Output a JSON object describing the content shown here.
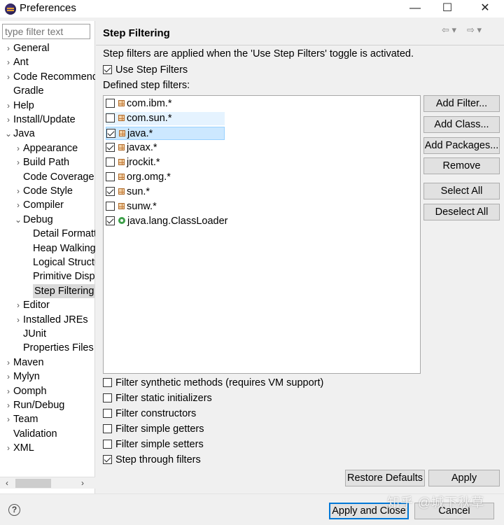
{
  "window": {
    "title": "Preferences",
    "minimize": "—",
    "maximize": "☐",
    "close": "✕"
  },
  "filter": {
    "placeholder": "type filter text"
  },
  "tree": [
    {
      "label": "General",
      "chev": "›"
    },
    {
      "label": "Ant",
      "chev": "›"
    },
    {
      "label": "Code Recommenders",
      "chev": "›"
    },
    {
      "label": "Gradle",
      "chev": ""
    },
    {
      "label": "Help",
      "chev": "›"
    },
    {
      "label": "Install/Update",
      "chev": "›"
    },
    {
      "label": "Java",
      "chev": "⌄"
    },
    {
      "label": "Appearance",
      "chev": "›"
    },
    {
      "label": "Build Path",
      "chev": "›"
    },
    {
      "label": "Code Coverage",
      "chev": ""
    },
    {
      "label": "Code Style",
      "chev": "›"
    },
    {
      "label": "Compiler",
      "chev": "›"
    },
    {
      "label": "Debug",
      "chev": "⌄"
    },
    {
      "label": "Detail Formatters",
      "chev": ""
    },
    {
      "label": "Heap Walking",
      "chev": ""
    },
    {
      "label": "Logical Structures",
      "chev": ""
    },
    {
      "label": "Primitive Display Options",
      "chev": ""
    },
    {
      "label": "Step Filtering",
      "chev": ""
    },
    {
      "label": "Editor",
      "chev": "›"
    },
    {
      "label": "Installed JREs",
      "chev": "›"
    },
    {
      "label": "JUnit",
      "chev": ""
    },
    {
      "label": "Properties Files Editor",
      "chev": ""
    },
    {
      "label": "Maven",
      "chev": "›"
    },
    {
      "label": "Mylyn",
      "chev": "›"
    },
    {
      "label": "Oomph",
      "chev": "›"
    },
    {
      "label": "Run/Debug",
      "chev": "›"
    },
    {
      "label": "Team",
      "chev": "›"
    },
    {
      "label": "Validation",
      "chev": ""
    },
    {
      "label": "XML",
      "chev": "›"
    }
  ],
  "scroll": {
    "left": "‹",
    "right": "›"
  },
  "page": {
    "title": "Step Filtering",
    "nav_back": "⇦ ▾",
    "nav_fwd": "⇨ ▾",
    "description": "Step filters are applied when the 'Use Step Filters' toggle is activated.",
    "use_step_filters": "Use Step Filters",
    "defined_label": "Defined step filters:"
  },
  "filters": [
    {
      "name": "com.ibm.*",
      "checked": false,
      "icon": "package-icon"
    },
    {
      "name": "com.sun.*",
      "checked": false,
      "icon": "package-icon"
    },
    {
      "name": "java.*",
      "checked": true,
      "icon": "package-icon"
    },
    {
      "name": "javax.*",
      "checked": true,
      "icon": "package-icon"
    },
    {
      "name": "jrockit.*",
      "checked": false,
      "icon": "package-icon"
    },
    {
      "name": "org.omg.*",
      "checked": false,
      "icon": "package-icon"
    },
    {
      "name": "sun.*",
      "checked": true,
      "icon": "package-icon"
    },
    {
      "name": "sunw.*",
      "checked": false,
      "icon": "package-icon"
    },
    {
      "name": "java.lang.ClassLoader",
      "checked": true,
      "icon": "class-icon"
    }
  ],
  "side_buttons": {
    "add_filter": "Add Filter...",
    "add_class": "Add Class...",
    "add_packages": "Add Packages...",
    "remove": "Remove",
    "select_all": "Select All",
    "deselect_all": "Deselect All"
  },
  "options": [
    {
      "label": "Filter synthetic methods (requires VM support)",
      "checked": false
    },
    {
      "label": "Filter static initializers",
      "checked": false
    },
    {
      "label": "Filter constructors",
      "checked": false
    },
    {
      "label": "Filter simple getters",
      "checked": false
    },
    {
      "label": "Filter simple setters",
      "checked": false
    },
    {
      "label": "Step through filters",
      "checked": true
    }
  ],
  "buttons": {
    "restore_defaults": "Restore Defaults",
    "apply": "Apply",
    "apply_and_close": "Apply and Close",
    "cancel": "Cancel",
    "help": "?"
  },
  "watermark": "知乎 @城下秋草"
}
